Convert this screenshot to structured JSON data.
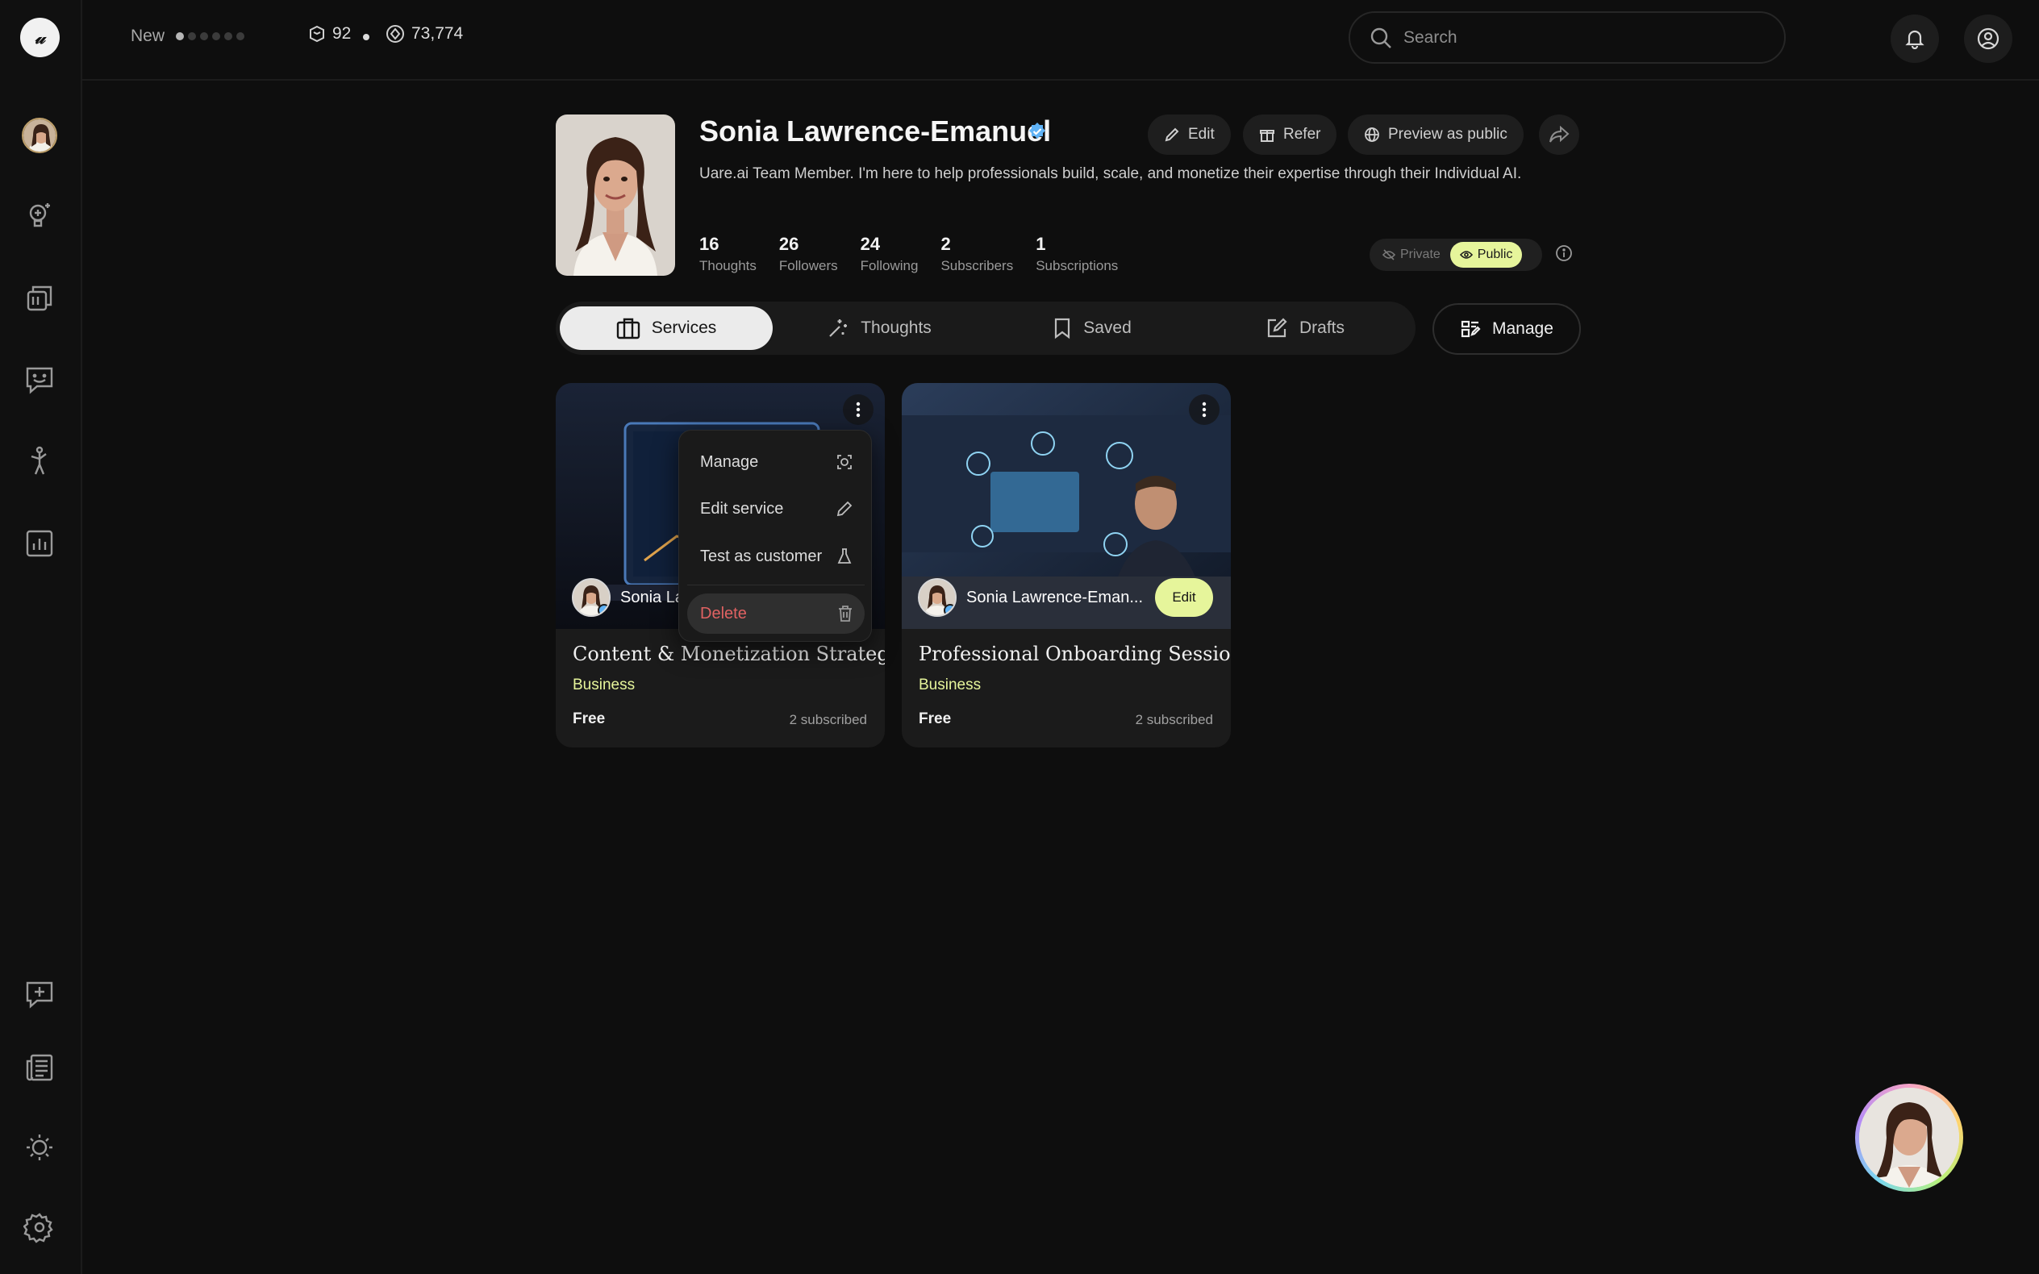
{
  "app": {
    "logo_text": "𝓊",
    "title": "Uare.ai"
  },
  "colors": {
    "accent": "#e6f59b",
    "danger": "#e06262",
    "background": "#0e0e0e",
    "verified": "#5fb2f5"
  },
  "sidebar": {
    "items": [
      {
        "name": "profile-avatar"
      },
      {
        "name": "ideas-icon"
      },
      {
        "name": "services-icon"
      },
      {
        "name": "chat-icon"
      },
      {
        "name": "activity-icon"
      },
      {
        "name": "analytics-icon"
      },
      {
        "name": "new-message-icon"
      },
      {
        "name": "news-icon"
      },
      {
        "name": "theme-icon"
      },
      {
        "name": "settings-icon"
      }
    ]
  },
  "topbar": {
    "new_label": "New",
    "progress_dots": 6,
    "progress_active": 1,
    "tokens": "92",
    "credits": "73,774",
    "search_placeholder": "Search"
  },
  "profile": {
    "name": "Sonia Lawrence-Emanuel",
    "bio": "Uare.ai Team Member. I'm here to help professionals build, scale, and monetize their expertise through their Individual AI.",
    "actions": {
      "edit": "Edit",
      "refer": "Refer",
      "preview": "Preview as public"
    },
    "stats": [
      {
        "value": "16",
        "label": "Thoughts"
      },
      {
        "value": "26",
        "label": "Followers"
      },
      {
        "value": "24",
        "label": "Following"
      },
      {
        "value": "2",
        "label": "Subscribers"
      },
      {
        "value": "1",
        "label": "Subscriptions"
      }
    ],
    "visibility": {
      "private": "Private",
      "public": "Public",
      "selected": "Public"
    }
  },
  "tabs": [
    {
      "label": "Services",
      "active": true
    },
    {
      "label": "Thoughts",
      "active": false
    },
    {
      "label": "Saved",
      "active": false
    },
    {
      "label": "Drafts",
      "active": false
    }
  ],
  "manage_label": "Manage",
  "cards": [
    {
      "author": "Sonia La",
      "title": "Content & Monetization Strategy",
      "category": "Business",
      "price": "Free",
      "subscribed": "2 subscribed"
    },
    {
      "author": "Sonia Lawrence-Eman...",
      "edit_label": "Edit",
      "title": "Professional Onboarding Session",
      "category": "Business",
      "price": "Free",
      "subscribed": "2 subscribed"
    }
  ],
  "context_menu": {
    "items": [
      {
        "label": "Manage",
        "icon": "manage-icon"
      },
      {
        "label": "Edit service",
        "icon": "pencil-icon"
      },
      {
        "label": "Test as customer",
        "icon": "flask-icon"
      },
      {
        "label": "Delete",
        "icon": "trash-icon"
      }
    ]
  }
}
